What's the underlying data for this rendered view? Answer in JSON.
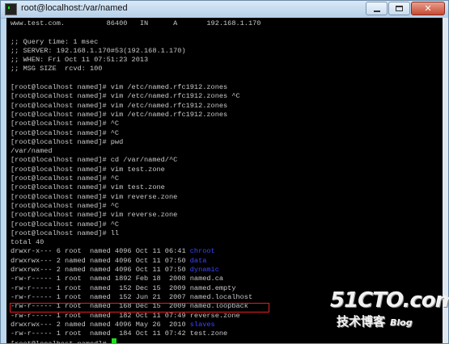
{
  "window": {
    "title": "root@localhost:/var/named",
    "controls": {
      "minimize": "minimize",
      "maximize": "maximize",
      "close": "close"
    }
  },
  "colors": {
    "terminal_bg": "#000000",
    "terminal_fg": "#c8c8c8",
    "dir": "#3b46ff",
    "cursor": "#1fe01f",
    "highlight": "#e21f1f"
  },
  "terminal": {
    "lines": [
      "www.test.com.          86400   IN      A       192.168.1.170",
      "",
      ";; Query time: 1 msec",
      ";; SERVER: 192.168.1.170#53(192.168.1.170)",
      ";; WHEN: Fri Oct 11 07:51:23 2013",
      ";; MSG SIZE  rcvd: 100",
      "",
      "[root@localhost named]# vim /etc/named.rfc1912.zones",
      "[root@localhost named]# vim /etc/named.rfc1912.zones ^C",
      "[root@localhost named]# vim /etc/named.rfc1912.zones",
      "[root@localhost named]# vim /etc/named.rfc1912.zones",
      "[root@localhost named]# ^C",
      "[root@localhost named]# ^C",
      "[root@localhost named]# pwd",
      "/var/named",
      "[root@localhost named]# cd /var/named/^C",
      "[root@localhost named]# vim test.zone",
      "[root@localhost named]# ^C",
      "[root@localhost named]# vim test.zone",
      "[root@localhost named]# vim reverse.zone",
      "[root@localhost named]# ^C",
      "[root@localhost named]# vim reverse.zone",
      "[root@localhost named]# ^C",
      "[root@localhost named]# ll",
      "total 40"
    ],
    "listing": [
      {
        "perm": "drwxr-x--- 6 root  named 4096 Oct 11 06:41 ",
        "name": "chroot",
        "is_dir": true
      },
      {
        "perm": "drwxrwx--- 2 named named 4096 Oct 11 07:50 ",
        "name": "data",
        "is_dir": true
      },
      {
        "perm": "drwxrwx--- 2 named named 4096 Oct 11 07:50 ",
        "name": "dynamic",
        "is_dir": true
      },
      {
        "perm": "-rw-r----- 1 root  named 1892 Feb 18  2008 ",
        "name": "named.ca",
        "is_dir": false
      },
      {
        "perm": "-rw-r----- 1 root  named  152 Dec 15  2009 ",
        "name": "named.empty",
        "is_dir": false
      },
      {
        "perm": "-rw-r----- 1 root  named  152 Jun 21  2007 ",
        "name": "named.localhost",
        "is_dir": false
      },
      {
        "perm": "-rw-r----- 1 root  named  168 Dec 15  2009 ",
        "name": "named.loopback",
        "is_dir": false
      },
      {
        "perm": "-rw-r----- 1 root  named  182 Oct 11 07:49 ",
        "name": "reverse.zone",
        "is_dir": false
      },
      {
        "perm": "drwxrwx--- 2 named named 4096 May 26  2010 ",
        "name": "slaves",
        "is_dir": true
      },
      {
        "perm": "-rw-r----- 1 root  named  184 Oct 11 07:42 ",
        "name": "test.zone",
        "is_dir": false
      }
    ],
    "prompt": "[root@localhost named]# "
  },
  "watermark": {
    "logo": "51CTO.com",
    "subtitle": "技术博客",
    "blog": "Blog"
  }
}
